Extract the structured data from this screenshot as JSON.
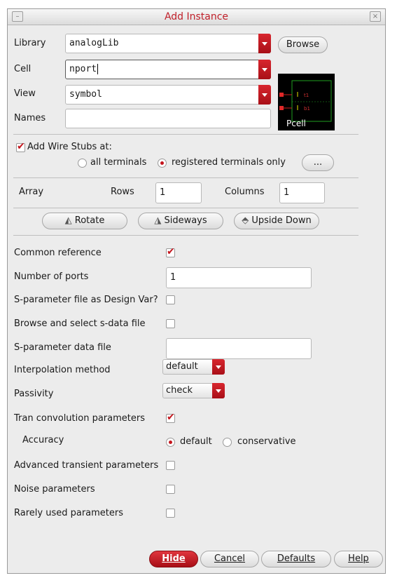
{
  "window": {
    "title": "Add Instance",
    "close_glyph": "×",
    "menu_glyph": "–"
  },
  "library": {
    "label": "Library",
    "value": "analogLib",
    "browse_label": "Browse"
  },
  "cell": {
    "label": "Cell",
    "value": "nport"
  },
  "view": {
    "label": "View",
    "value": "symbol"
  },
  "names": {
    "label": "Names",
    "value": ""
  },
  "preview": {
    "label": "Pcell",
    "pin_top": "t1",
    "pin_bottom": "b1"
  },
  "wire_stubs": {
    "label": "Add Wire Stubs at:",
    "checked": true,
    "option_all": "all terminals",
    "option_registered": "registered terminals only",
    "selected": "registered",
    "more_label": "..."
  },
  "array": {
    "label": "Array",
    "rows_label": "Rows",
    "rows_value": "1",
    "columns_label": "Columns",
    "columns_value": "1"
  },
  "transform": {
    "rotate": "Rotate",
    "sideways": "Sideways",
    "upside_down": "Upside Down"
  },
  "params": {
    "common_reference": {
      "label": "Common reference",
      "checked": true
    },
    "number_of_ports": {
      "label": "Number of ports",
      "value": "1"
    },
    "sparam_design_var": {
      "label": "S-parameter file as Design Var?",
      "checked": false
    },
    "browse_sdata": {
      "label": "Browse and select s-data file",
      "checked": false
    },
    "sparam_data_file": {
      "label": "S-parameter data file",
      "value": ""
    },
    "interpolation": {
      "label": "Interpolation method",
      "value": "default"
    },
    "passivity": {
      "label": "Passivity",
      "value": "check"
    },
    "tran_conv": {
      "label": "Tran convolution parameters",
      "checked": true
    },
    "accuracy": {
      "label": "Accuracy",
      "option_default": "default",
      "option_conservative": "conservative",
      "selected": "default"
    },
    "adv_transient": {
      "label": "Advanced transient parameters",
      "checked": false
    },
    "noise": {
      "label": "Noise parameters",
      "checked": false
    },
    "rarely_used": {
      "label": "Rarely used parameters",
      "checked": false
    }
  },
  "footer": {
    "hide": "Hide",
    "cancel": "Cancel",
    "defaults": "Defaults",
    "help": "Help"
  },
  "colors": {
    "accent": "#c4141c",
    "title": "#c0202a"
  }
}
